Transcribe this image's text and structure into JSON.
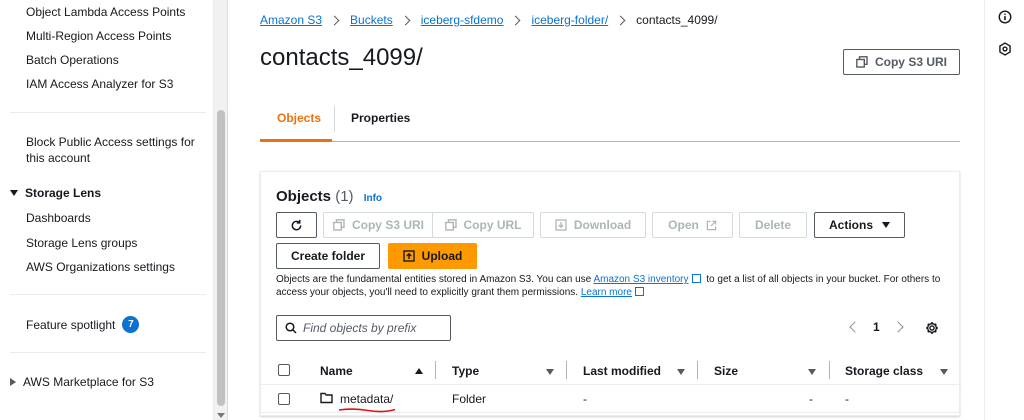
{
  "sidebar": {
    "items_top": [
      "Object Lambda Access Points",
      "Multi-Region Access Points",
      "Batch Operations",
      "IAM Access Analyzer for S3"
    ],
    "block_public_line1": "Block Public Access settings for",
    "block_public_line2": "this account",
    "storage_lens": {
      "label": "Storage Lens",
      "items": [
        "Dashboards",
        "Storage Lens groups",
        "AWS Organizations settings"
      ]
    },
    "feature_spotlight": {
      "label": "Feature spotlight",
      "badge": "7"
    },
    "marketplace": "AWS Marketplace for S3"
  },
  "breadcrumb": {
    "items": [
      "Amazon S3",
      "Buckets",
      "iceberg-sfdemo",
      "iceberg-folder/"
    ],
    "current": "contacts_4099/"
  },
  "page": {
    "title": "contacts_4099/",
    "copy_uri_label": "Copy S3 URI"
  },
  "tabs": {
    "objects": "Objects",
    "properties": "Properties"
  },
  "objects_panel": {
    "title": "Objects",
    "count": "(1)",
    "info": "Info",
    "buttons": {
      "copy_s3_uri": "Copy S3 URI",
      "copy_url": "Copy URL",
      "download": "Download",
      "open": "Open",
      "delete": "Delete",
      "actions": "Actions",
      "create_folder": "Create folder",
      "upload": "Upload"
    },
    "description_part1": "Objects are the fundamental entities stored in Amazon S3. You can use",
    "description_link1": "Amazon S3 inventory",
    "description_part2": "to get a list of all objects in your bucket. For others to access your objects, you'll need to explicitly grant them permissions.",
    "description_link2": "Learn more",
    "search_placeholder": "Find objects by prefix",
    "page_number": "1",
    "columns": {
      "name": "Name",
      "type": "Type",
      "last_modified": "Last modified",
      "size": "Size",
      "storage_class": "Storage class"
    },
    "rows": [
      {
        "name": "metadata/",
        "type": "Folder",
        "last_modified": "-",
        "size": "-",
        "storage_class": "-"
      }
    ]
  },
  "colors": {
    "accent_orange": "#ec7211",
    "link_blue": "#0972d3",
    "upload_orange": "#ff9900",
    "annotation_red": "#d91515"
  }
}
